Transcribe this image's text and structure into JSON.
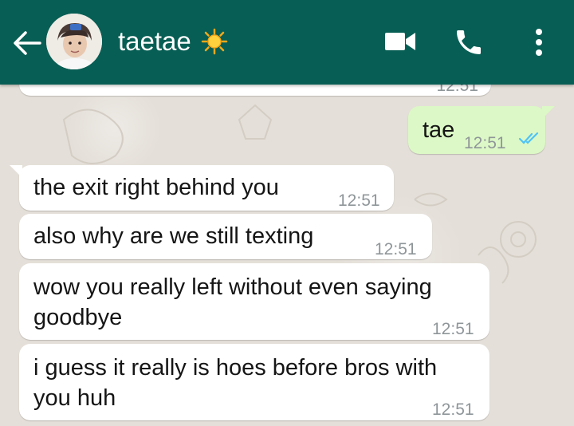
{
  "header": {
    "contact_name": "taetae",
    "back_icon": "arrow-left-icon",
    "video_icon": "video-call-icon",
    "call_icon": "phone-icon",
    "menu_icon": "more-vertical-icon",
    "status_emoji_icon": "sun-icon",
    "color": "#075e54"
  },
  "messages": {
    "prev_time": "12:51",
    "outgoing": {
      "text": "tae",
      "time": "12:51",
      "status": "read"
    },
    "incoming": [
      {
        "text": "the exit right behind you",
        "time": "12:51"
      },
      {
        "text": "also why are we still texting",
        "time": "12:51"
      },
      {
        "line1": "wow you really left without even saying",
        "line2": "goodbye",
        "time": "12:51"
      },
      {
        "line1": "i guess it really is hoes before bros with",
        "line2": "you huh",
        "time": "12:51"
      }
    ]
  },
  "colors": {
    "outgoing_bubble": "#dcf8c6",
    "incoming_bubble": "#ffffff",
    "read_ticks": "#4fc3f7",
    "chat_background": "#e4dfd8"
  }
}
